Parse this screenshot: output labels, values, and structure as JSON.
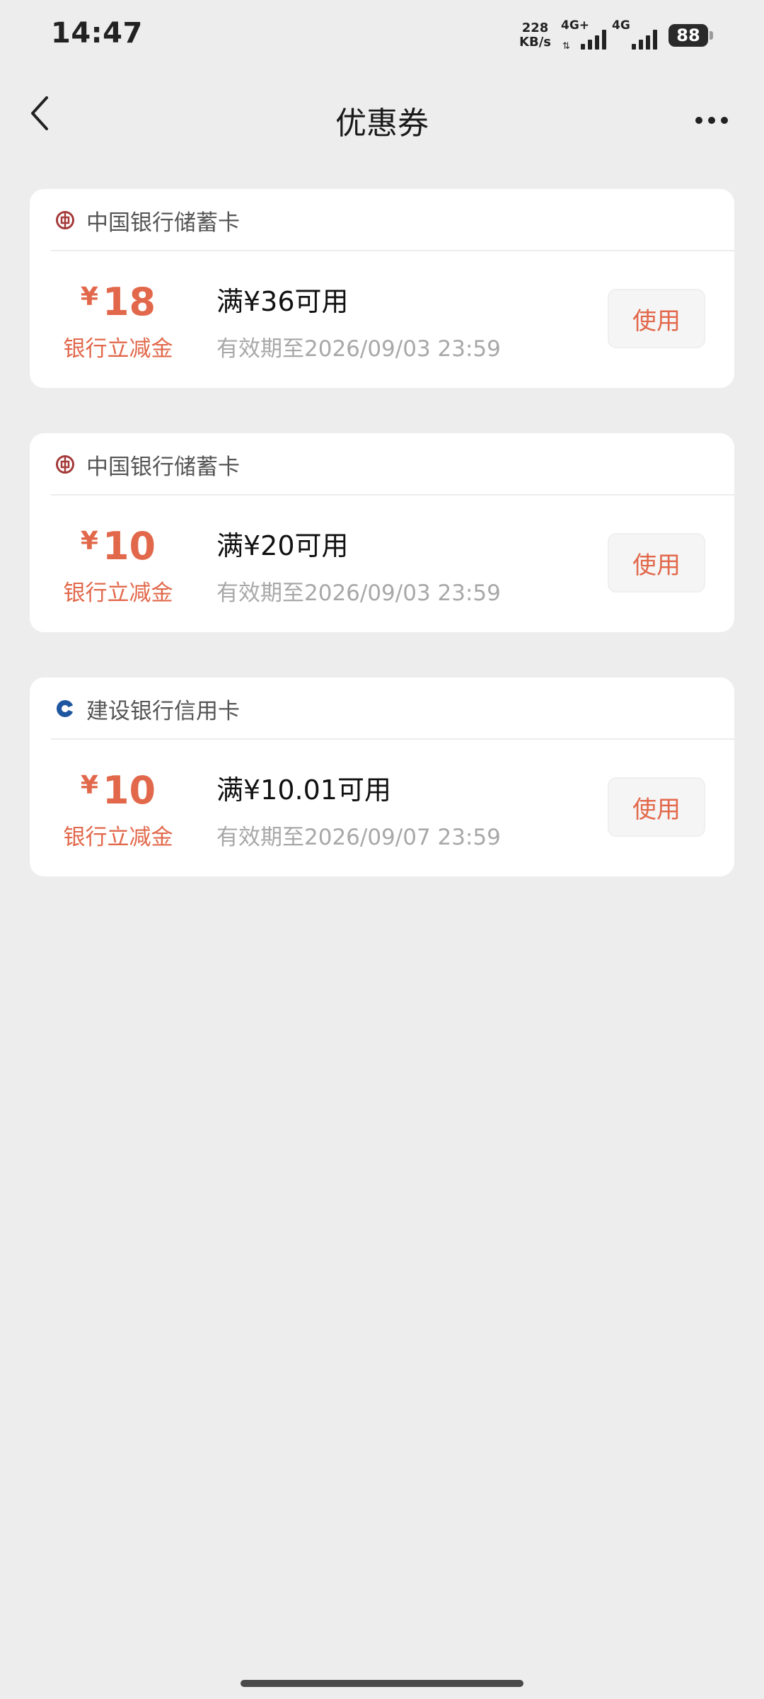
{
  "status_bar": {
    "time": "14:47",
    "net_speed_value": "228",
    "net_speed_unit": "KB/s",
    "signal1_label": "4G+",
    "signal2_label": "4G",
    "battery": "88"
  },
  "header": {
    "title": "优惠券",
    "back_icon": "chevron-left-icon",
    "more_icon": "more-dots-icon"
  },
  "colors": {
    "accent": "#e2684b",
    "boc_icon": "#a53a3a",
    "ccb_icon": "#1f56a0",
    "background": "#ededed"
  },
  "coupons": [
    {
      "bank_icon": "boc-logo-icon",
      "bank": "中国银行储蓄卡",
      "currency": "¥",
      "amount": "18",
      "type": "银行立减金",
      "condition": "满¥36可用",
      "validity": "有效期至2026/09/03 23:59",
      "button": "使用"
    },
    {
      "bank_icon": "boc-logo-icon",
      "bank": "中国银行储蓄卡",
      "currency": "¥",
      "amount": "10",
      "type": "银行立减金",
      "condition": "满¥20可用",
      "validity": "有效期至2026/09/03 23:59",
      "button": "使用"
    },
    {
      "bank_icon": "ccb-logo-icon",
      "bank": "建设银行信用卡",
      "currency": "¥",
      "amount": "10",
      "type": "银行立减金",
      "condition": "满¥10.01可用",
      "validity": "有效期至2026/09/07 23:59",
      "button": "使用"
    }
  ]
}
